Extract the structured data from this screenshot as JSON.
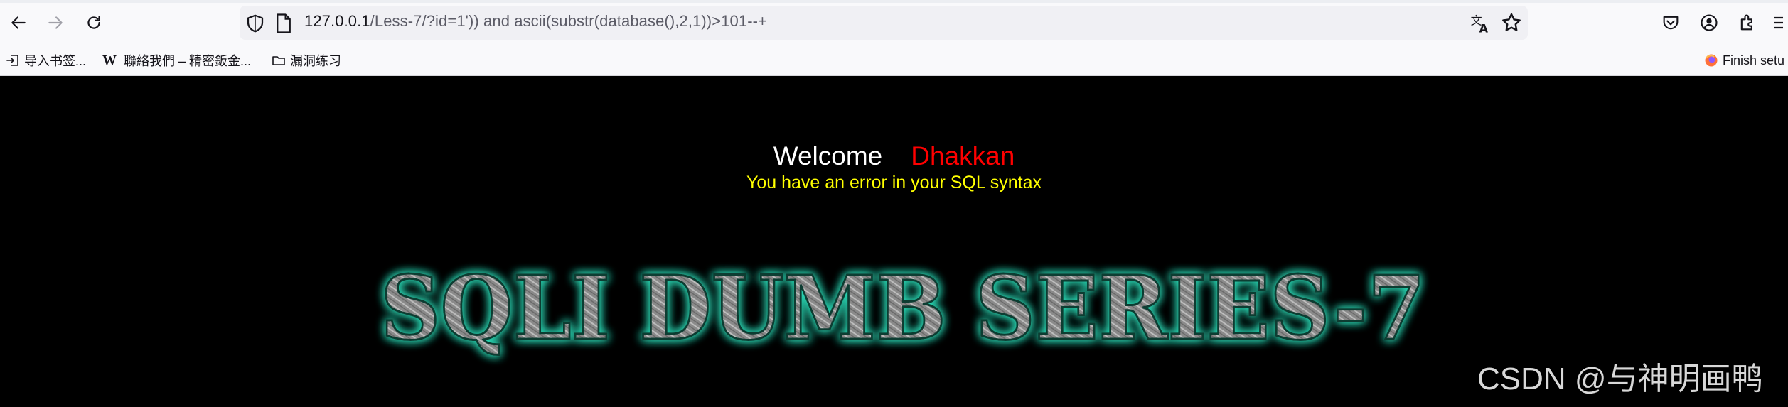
{
  "browser": {
    "url_host": "127.0.0.1",
    "url_rest": "/Less-7/?id=1')) and ascii(substr(database(),2,1))>101--+",
    "icons": {
      "back": "back-arrow-icon",
      "forward": "forward-arrow-icon",
      "reload": "reload-icon",
      "shield": "shield-icon",
      "page": "page-icon",
      "translate": "translate-icon",
      "bookmark_star": "star-icon",
      "pocket": "pocket-icon",
      "account": "account-icon",
      "extensions": "extensions-icon",
      "menu": "menu-icon"
    },
    "bookmarks": [
      {
        "label": "导入书签...",
        "icon": "import-icon"
      },
      {
        "label": "聯絡我們 – 精密鈑金...",
        "icon": "w-logo"
      },
      {
        "label": "漏洞练习",
        "icon": "folder-icon"
      }
    ],
    "finish_setup": "Finish setu"
  },
  "page": {
    "welcome": "Welcome",
    "username": "Dhakkan",
    "error": "You have an error in your SQL syntax",
    "banner_title": "SQLI DUMB SERIES-7",
    "watermark": "CSDN @与神明画鸭"
  },
  "colors": {
    "page_bg": "#000000",
    "welcome": "#ffffff",
    "username": "#ff0000",
    "error": "#ffff00",
    "banner_glow": "#2ad8b4"
  }
}
